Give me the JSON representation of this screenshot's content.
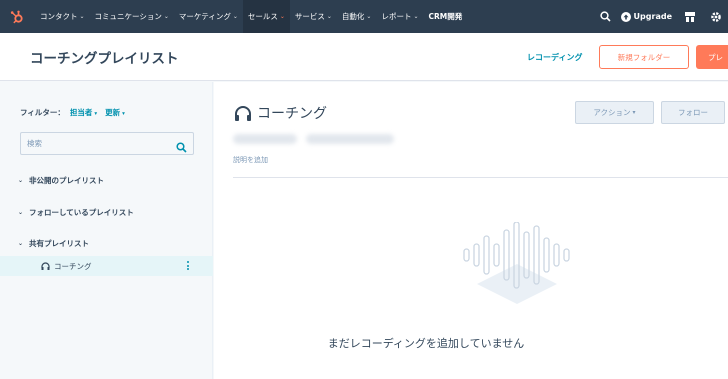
{
  "topnav": {
    "items": [
      {
        "label": "コンタクト",
        "chevron": "⌄",
        "active": false
      },
      {
        "label": "コミュニケーション",
        "chevron": "⌄",
        "active": false
      },
      {
        "label": "マーケティング",
        "chevron": "⌄",
        "active": false
      },
      {
        "label": "セールス",
        "chevron": "⌄",
        "active": true
      },
      {
        "label": "サービス",
        "chevron": "⌄",
        "active": false
      },
      {
        "label": "自動化",
        "chevron": "⌄",
        "active": false
      },
      {
        "label": "レポート",
        "chevron": "⌄",
        "active": false
      },
      {
        "label": "CRM開発",
        "chevron": "",
        "active": false
      }
    ],
    "upgrade_label": "Upgrade",
    "icons": [
      "hubspot-logo-icon",
      "search-icon",
      "upgrade-icon",
      "marketplace-icon",
      "settings-icon"
    ]
  },
  "header": {
    "title": "コーチングプレイリスト",
    "recordings_link": "レコーディング",
    "new_folder_button": "新規フォルダー",
    "primary_button": "プレ"
  },
  "sidebar": {
    "filter_label": "フィルター：",
    "filter_owner": "担当者",
    "filter_updated": "更新",
    "search_placeholder": "検索",
    "groups": {
      "private": "非公開のプレイリスト",
      "following": "フォローしているプレイリスト",
      "shared": "共有プレイリスト"
    },
    "selected_playlist": "コーチング"
  },
  "main": {
    "title": "コーチング",
    "action_button": "アクション",
    "action_chevron": "▾",
    "follow_button": "フォロー",
    "add_description": "説明を追加",
    "empty_state": "まだレコーディングを追加していません"
  },
  "colors": {
    "nav_bg": "#2d3e50",
    "accent_orange": "#ff7a59",
    "link_teal": "#0091ae",
    "text": "#33475b",
    "selected_bg": "#e5f5f8"
  }
}
